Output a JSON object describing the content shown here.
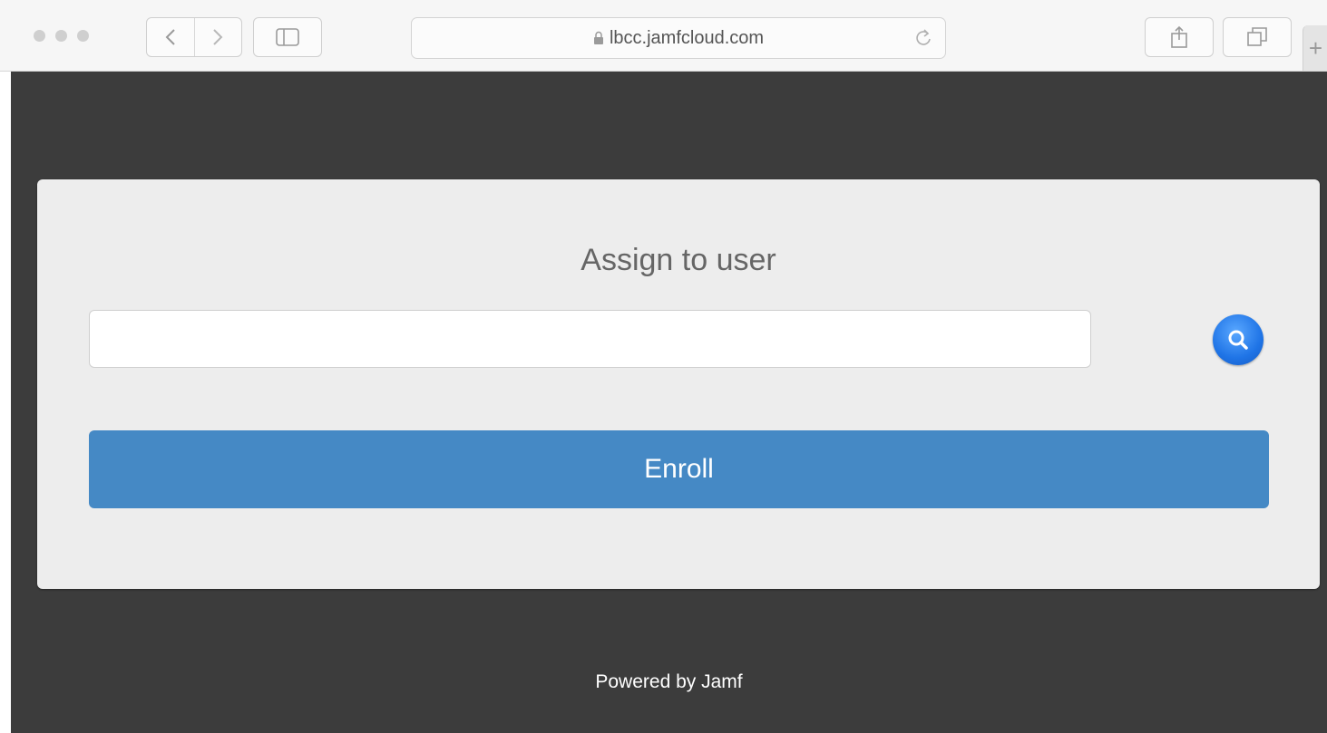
{
  "browser": {
    "url": "lbcc.jamfcloud.com",
    "icons": {
      "back": "chevron-left-icon",
      "forward": "chevron-right-icon",
      "sidebar": "sidebar-icon",
      "lock": "lock-icon",
      "reload": "reload-icon",
      "share": "share-icon",
      "tabs": "tabs-icon",
      "new_tab": "plus-icon"
    }
  },
  "enrollment": {
    "title": "Assign to user",
    "user_value": "",
    "enroll_label": "Enroll",
    "search_icon": "magnifier-icon"
  },
  "footer": {
    "powered_by": "Powered by Jamf"
  },
  "colors": {
    "page_background": "#3c3c3c",
    "card_background": "#ededed",
    "enroll_button": "#4589c5",
    "search_button": "#1f74e6"
  }
}
